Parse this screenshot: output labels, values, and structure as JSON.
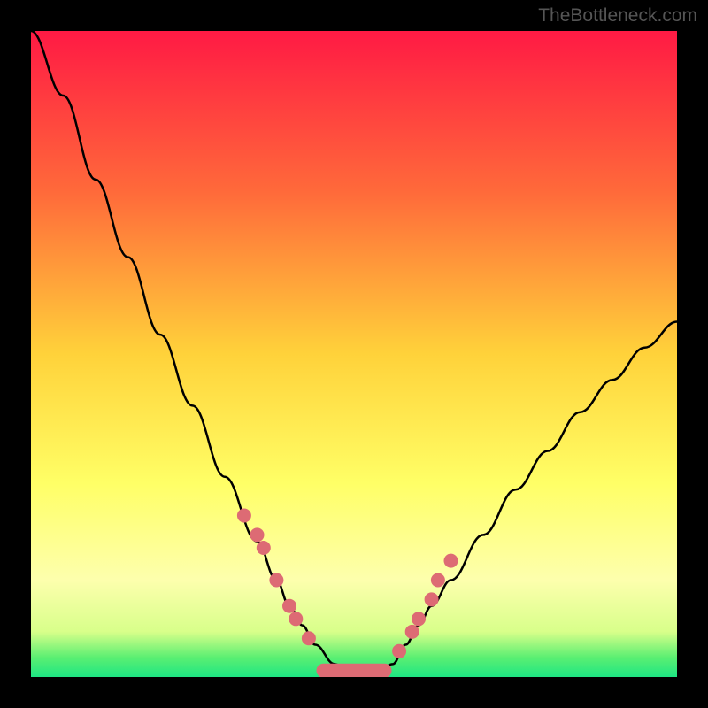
{
  "watermark": "TheBottleneck.com",
  "chart_data": {
    "type": "line",
    "title": "",
    "xlabel": "",
    "ylabel": "",
    "xlim": [
      0,
      100
    ],
    "ylim": [
      0,
      100
    ],
    "curve": {
      "description": "V-shaped bottleneck curve descending steeply from top-left, reaching minimum ~0 around x=45-55, then rising to ~55 at x=100",
      "x": [
        0,
        5,
        10,
        15,
        20,
        25,
        30,
        35,
        38,
        40,
        42,
        44,
        47,
        50,
        53,
        56,
        58,
        60,
        62,
        65,
        70,
        75,
        80,
        85,
        90,
        95,
        100
      ],
      "y": [
        100,
        90,
        77,
        65,
        53,
        42,
        31,
        21,
        15,
        11,
        8,
        5,
        2,
        0,
        0,
        2,
        5,
        8,
        11,
        15,
        22,
        29,
        35,
        41,
        46,
        51,
        55
      ]
    },
    "markers": {
      "description": "Scattered pink/salmon dots on both slopes of the V and along the flat bottom",
      "color": "#dd6b74",
      "left_cluster_x": [
        33,
        35,
        36,
        38,
        40,
        41,
        43
      ],
      "left_cluster_y": [
        25,
        22,
        20,
        15,
        11,
        9,
        6
      ],
      "bottom_cluster_x": [
        45,
        47,
        49,
        51,
        53,
        55
      ],
      "bottom_cluster_y": [
        2,
        1,
        0,
        0,
        1,
        2
      ],
      "right_cluster_x": [
        57,
        59,
        60,
        62,
        63,
        65
      ],
      "right_cluster_y": [
        4,
        7,
        9,
        12,
        15,
        18
      ]
    },
    "background_gradient": {
      "description": "Vertical gradient from red at top through orange/yellow to bright green strip at bottom",
      "stops": [
        {
          "offset": 0,
          "color": "#ff1a44"
        },
        {
          "offset": 25,
          "color": "#ff6a3a"
        },
        {
          "offset": 50,
          "color": "#ffd23a"
        },
        {
          "offset": 70,
          "color": "#ffff66"
        },
        {
          "offset": 85,
          "color": "#fdffad"
        },
        {
          "offset": 93,
          "color": "#d8ff8a"
        },
        {
          "offset": 97,
          "color": "#5aef72"
        },
        {
          "offset": 100,
          "color": "#1ee683"
        }
      ]
    }
  }
}
